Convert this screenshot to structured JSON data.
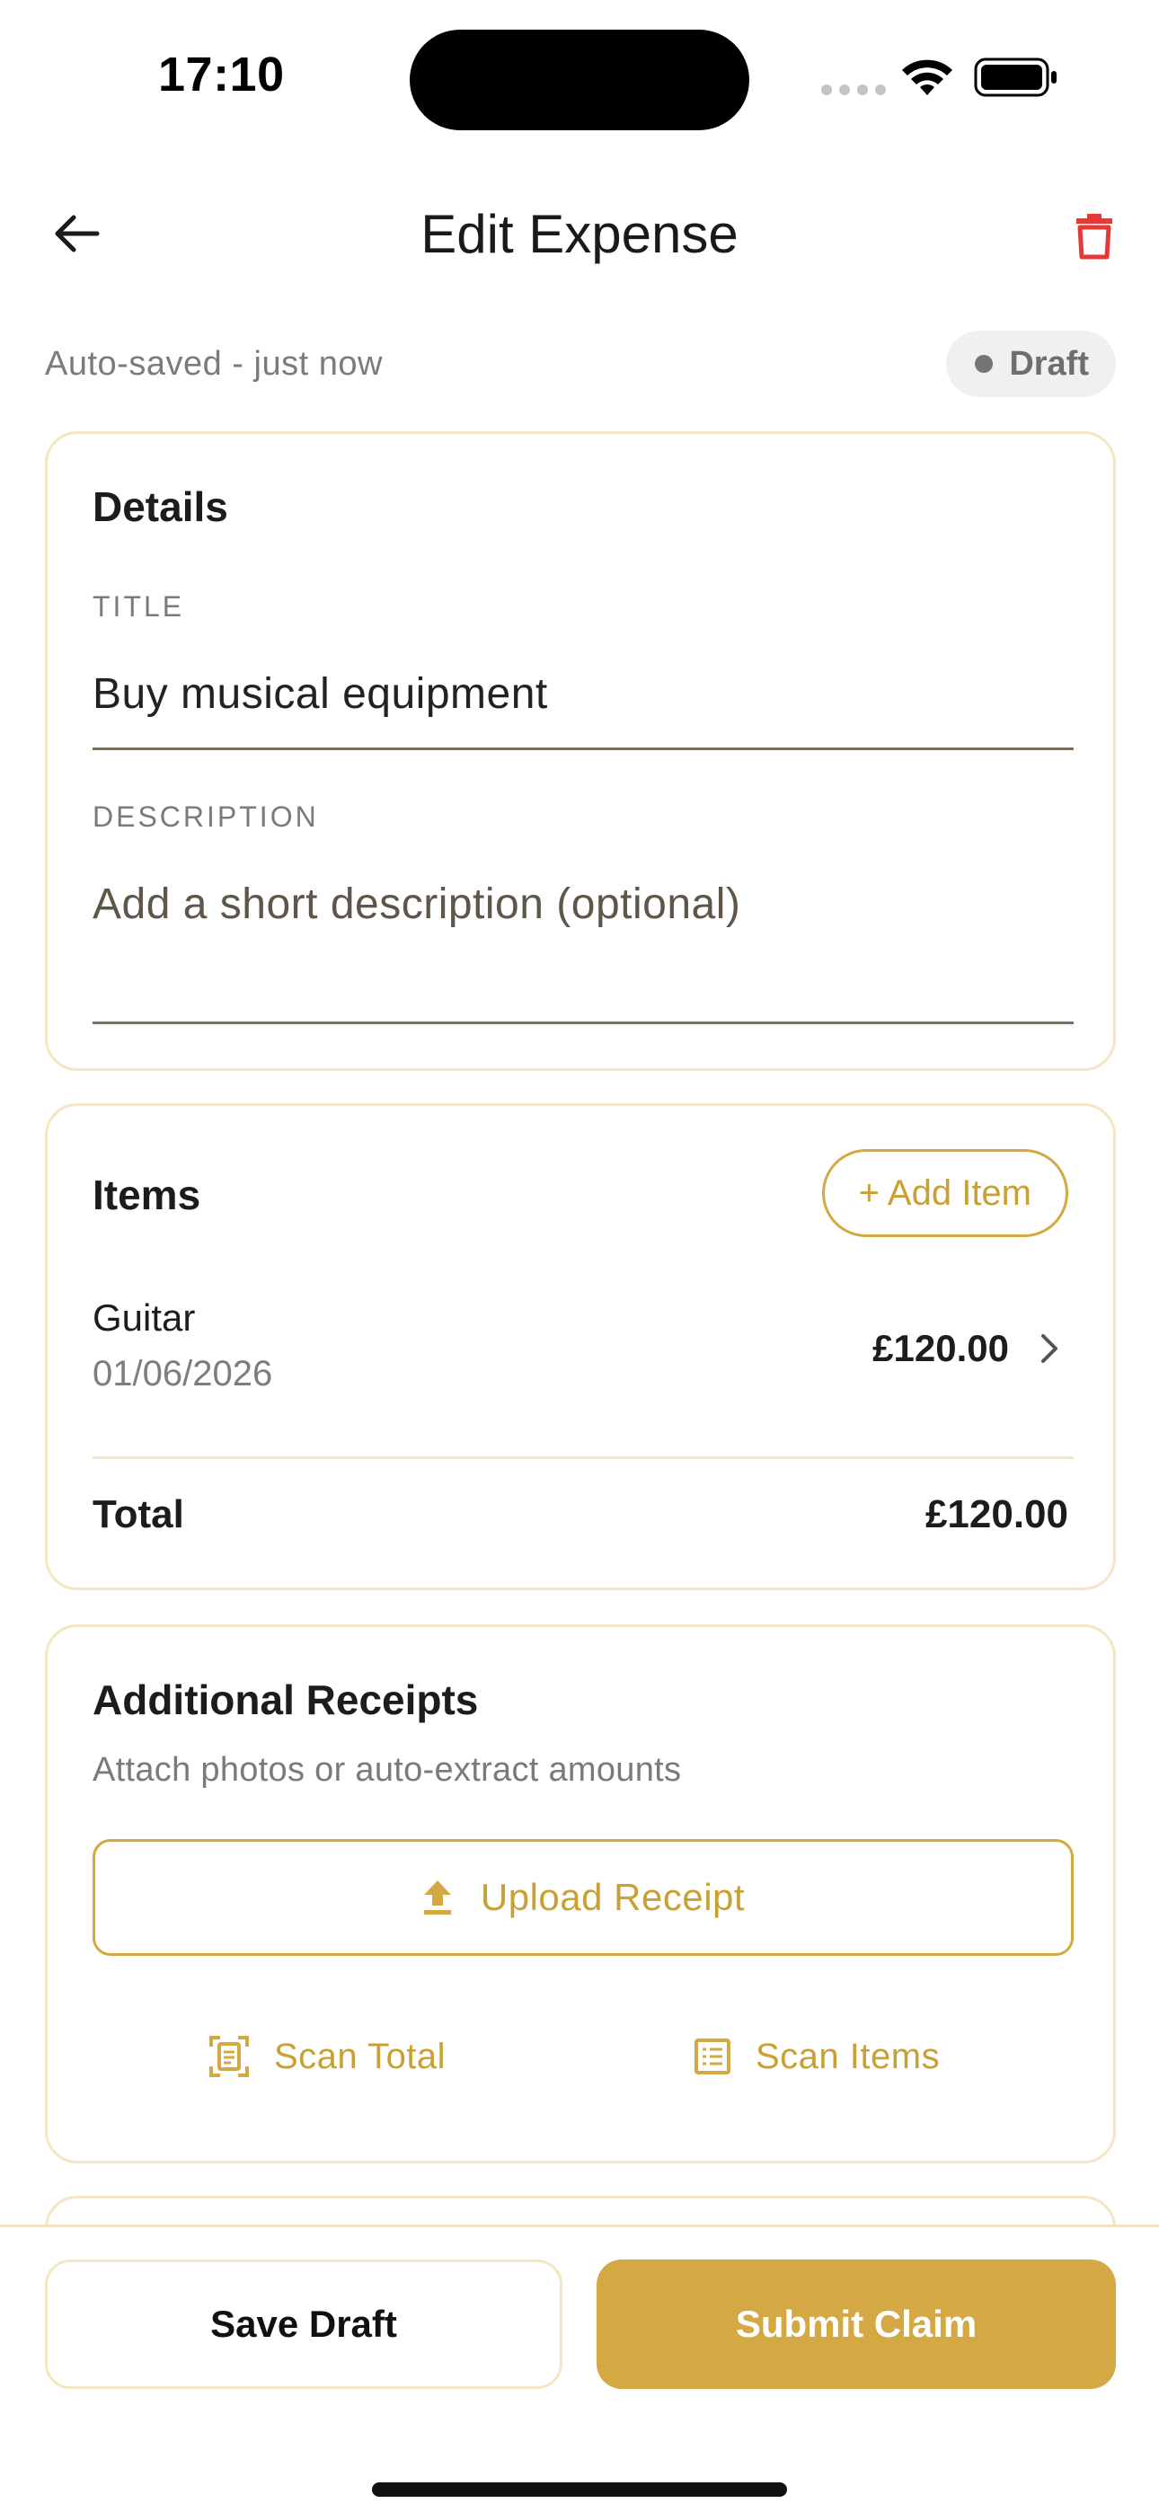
{
  "status_bar": {
    "time": "17:10"
  },
  "header": {
    "title": "Edit Expense"
  },
  "autosave": {
    "text": "Auto-saved - just now",
    "badge": "Draft"
  },
  "details": {
    "heading": "Details",
    "title_label": "TITLE",
    "title_value": "Buy musical equipment",
    "description_label": "DESCRIPTION",
    "description_placeholder": "Add a short description (optional)"
  },
  "items": {
    "heading": "Items",
    "add_button": "+ Add Item",
    "list": [
      {
        "name": "Guitar",
        "date": "01/06/2026",
        "amount": "£120.00"
      }
    ],
    "total_label": "Total",
    "total_value": "£120.00"
  },
  "receipts": {
    "heading": "Additional Receipts",
    "subtitle": "Attach photos or auto-extract amounts",
    "upload_label": "Upload Receipt",
    "scan_total_label": "Scan Total",
    "scan_items_label": "Scan Items"
  },
  "footer": {
    "save_draft": "Save Draft",
    "submit": "Submit Claim"
  },
  "colors": {
    "accent": "#d4a843",
    "card_border": "#f4e6c2",
    "delete": "#e53935"
  }
}
